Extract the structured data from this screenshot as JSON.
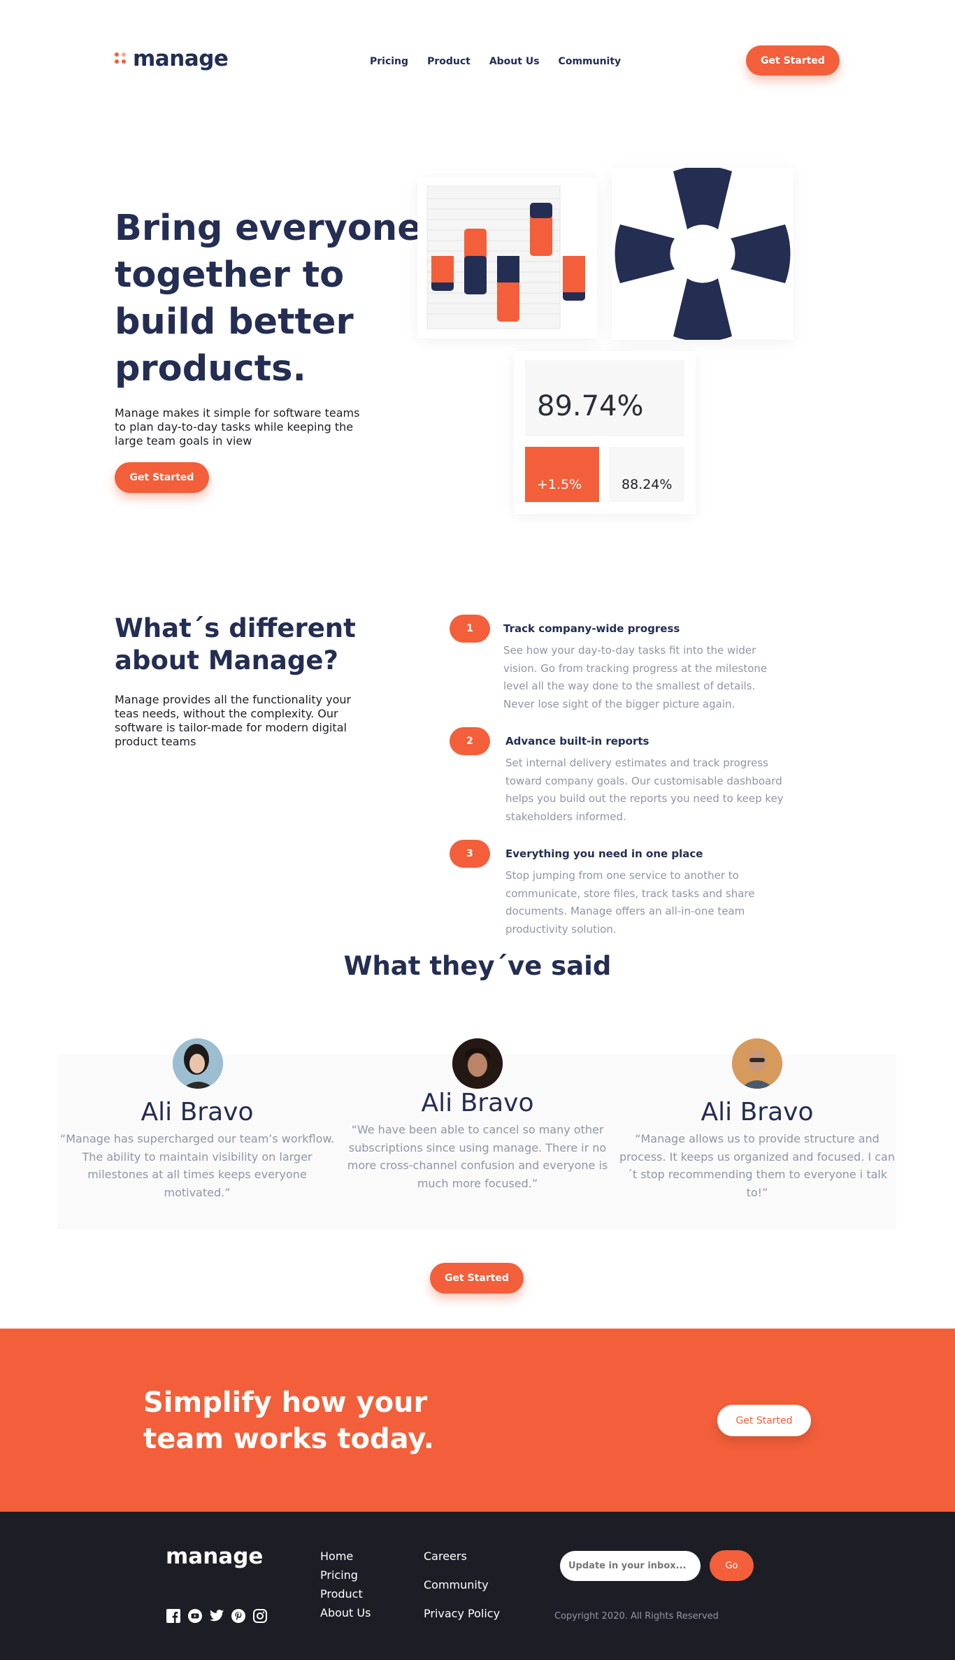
{
  "brand": {
    "name": "manage",
    "accent": "#f25f3a",
    "navy": "#242d52",
    "dark": "#1d1e25"
  },
  "nav": {
    "items": [
      "Pricing",
      "Product",
      "About Us",
      "Community"
    ],
    "cta": "Get Started"
  },
  "hero": {
    "title": "Bring everyone together to build better products.",
    "description": "Manage makes it simple for software teams to plan day-to-day tasks while keeping the large team goals in view",
    "cta": "Get Started"
  },
  "stats": {
    "main": "89.74%",
    "change": "+1.5%",
    "secondary": "88.24%"
  },
  "features": {
    "title": "What´s different about Manage?",
    "description": "Manage provides all the functionality your teas needs, without the complexity. Our software is tailor-made for modern digital product teams",
    "items": [
      {
        "number": "1",
        "title": "Track company-wide progress",
        "text": "See how your day-to-day tasks fit into the wider vision. Go from tracking progress at the milestone level all the way done to the smallest of details. Never lose sight of the bigger picture again."
      },
      {
        "number": "2",
        "title": "Advance built-in reports",
        "text": "Set internal delivery estimates and track progress toward company goals. Our customisable dashboard helps you build out the reports you need to keep key stakeholders informed."
      },
      {
        "number": "3",
        "title": "Everything you need in one place",
        "text": "Stop jumping from one service to another to communicate, store files, track tasks and share documents. Manage offers an all-in-one team productivity solution."
      }
    ]
  },
  "testimonials": {
    "title": "What they´ve said",
    "items": [
      {
        "name": "Ali Bravo",
        "quote": "“Manage has supercharged our team’s workflow. The ability to maintain visibility on larger milestones at all times keeps everyone motivated.”"
      },
      {
        "name": "Ali Bravo",
        "quote": "“We have been able to cancel so many other subscriptions since using manage. There ir no more cross-channel confusion and everyone is much more focused.”"
      },
      {
        "name": "Ali Bravo",
        "quote": "“Manage allows us to provide structure and process. It keeps us organized and focused. I can´t stop recommending them to everyone i talk to!”"
      }
    ],
    "cta": "Get Started"
  },
  "cta_band": {
    "title": "Simplify how your team works today.",
    "cta": "Get Started"
  },
  "footer": {
    "logo": "manage",
    "col1": [
      "Home",
      "Pricing",
      "Product",
      "About Us"
    ],
    "col2": [
      "Careers",
      "Community",
      "Privacy Policy"
    ],
    "newsletter_placeholder": "Update in your inbox...",
    "go": "Go",
    "copyright": "Copyright 2020. All Rights Reserved",
    "social_icons": [
      "facebook-icon",
      "youtube-icon",
      "twitter-icon",
      "pinterest-icon",
      "instagram-icon"
    ]
  }
}
